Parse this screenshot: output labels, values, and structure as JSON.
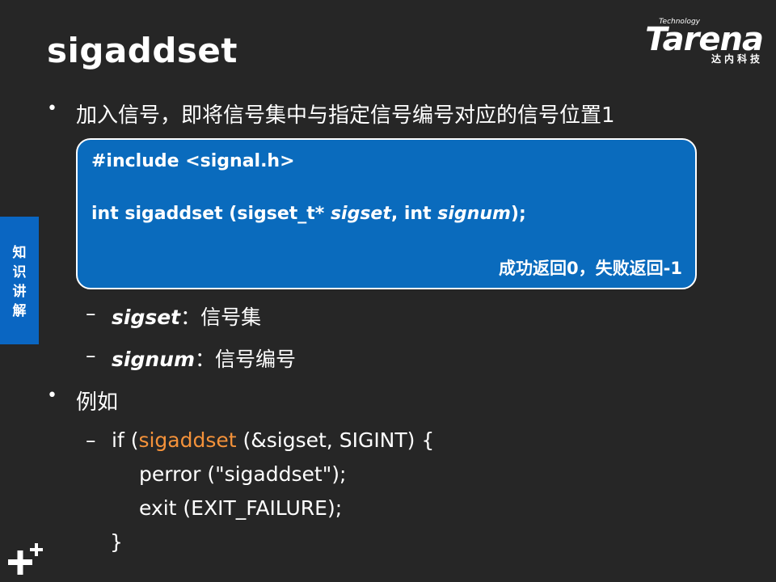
{
  "title": "sigaddset",
  "logo": {
    "tech": "Technology",
    "main": "Tarena",
    "sub": "达内科技"
  },
  "side_tab": {
    "chars": [
      "知",
      "识",
      "讲",
      "解"
    ]
  },
  "bullet_glyph": "•",
  "dash_glyph": "–",
  "bullets": {
    "first": "加入信号，即将信号集中与指定信号编号对应的信号位置1",
    "second": "例如"
  },
  "codebox": {
    "include": "#include <signal.h>",
    "proto_prefix": "int sigaddset (sigset_t* ",
    "proto_arg1": "sigset",
    "proto_mid": ", int ",
    "proto_arg2": "signum",
    "proto_suffix": ");",
    "result": "成功返回0，失败返回-1"
  },
  "params": [
    {
      "name": "sigset",
      "desc": "：信号集"
    },
    {
      "name": "signum",
      "desc": "：信号编号"
    }
  ],
  "example": {
    "line1_pre": "if (",
    "line1_fn": "sigaddset",
    "line1_post": " (&sigset, SIGINT) {",
    "line2": "perror (\"sigaddset\");",
    "line3": "exit (EXIT_FAILURE);",
    "line4": "}"
  },
  "colors": {
    "background": "#262626",
    "accent_blue": "#0a6bbd",
    "highlight_orange": "#f4923a"
  }
}
